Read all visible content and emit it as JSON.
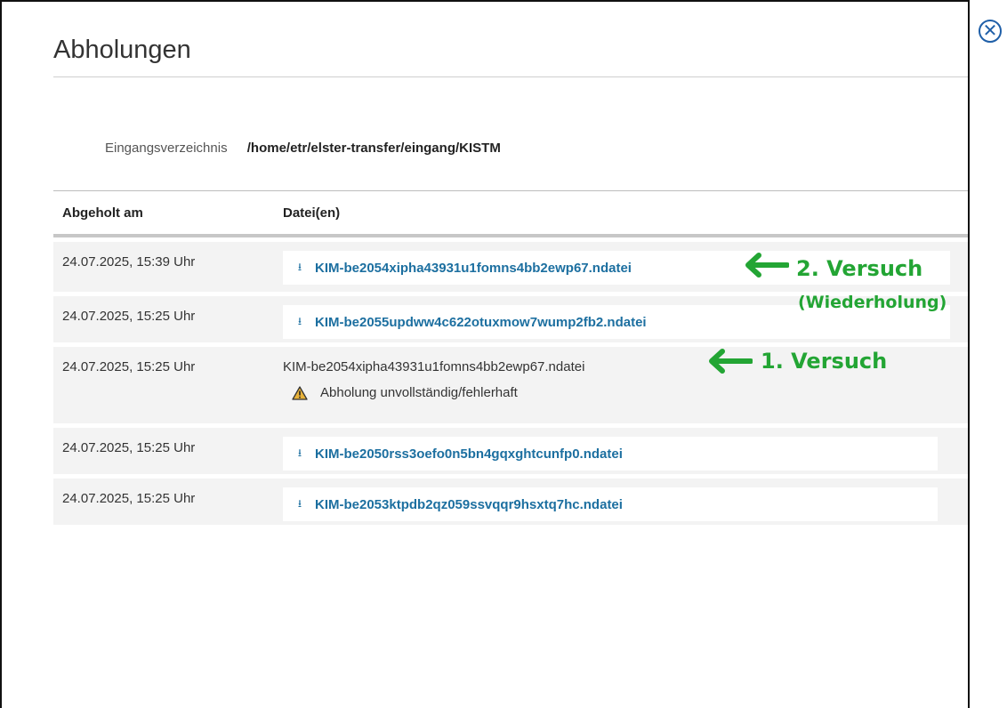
{
  "dialog": {
    "title": "Abholungen",
    "close_label": "✕"
  },
  "meta": {
    "label": "Eingangsverzeichnis",
    "value": "/home/etr/elster-transfer/eingang/KISTM"
  },
  "table": {
    "headers": [
      "Abgeholt am",
      "Datei(en)"
    ],
    "rows": [
      {
        "date": "24.07.2025, 15:39 Uhr",
        "file": "KIM-be2054xipha43931u1fomns4bb2ewp67.ndatei"
      },
      {
        "date": "24.07.2025, 15:25 Uhr",
        "file": "KIM-be2055updww4c622otuxmow7wump2fb2.ndatei"
      },
      {
        "date": "24.07.2025, 15:25 Uhr",
        "file": "KIM-be2054xipha43931u1fomns4bb2ewp67.ndatei",
        "warning": "Abholung unvollständig/fehlerhaft"
      },
      {
        "date": "24.07.2025, 15:25 Uhr",
        "file": "KIM-be2050rss3oefo0n5bn4gqxghtcunfp0.ndatei"
      },
      {
        "date": "24.07.2025, 15:25 Uhr",
        "file": "KIM-be2053ktpdb2qz059ssvqqr9hsxtq7hc.ndatei"
      }
    ]
  },
  "annotations": {
    "second_attempt": "2. Versuch",
    "second_attempt_note": "(Wiederholung)",
    "first_attempt": "1. Versuch",
    "color": "#23a534"
  },
  "icons": {
    "download": "download-tray-icon",
    "warning": "warning-triangle-icon",
    "close": "close-circle-icon"
  },
  "colors": {
    "link": "#1c6fa0",
    "close": "#1f5fa8",
    "row_bg": "#f3f3f3"
  }
}
